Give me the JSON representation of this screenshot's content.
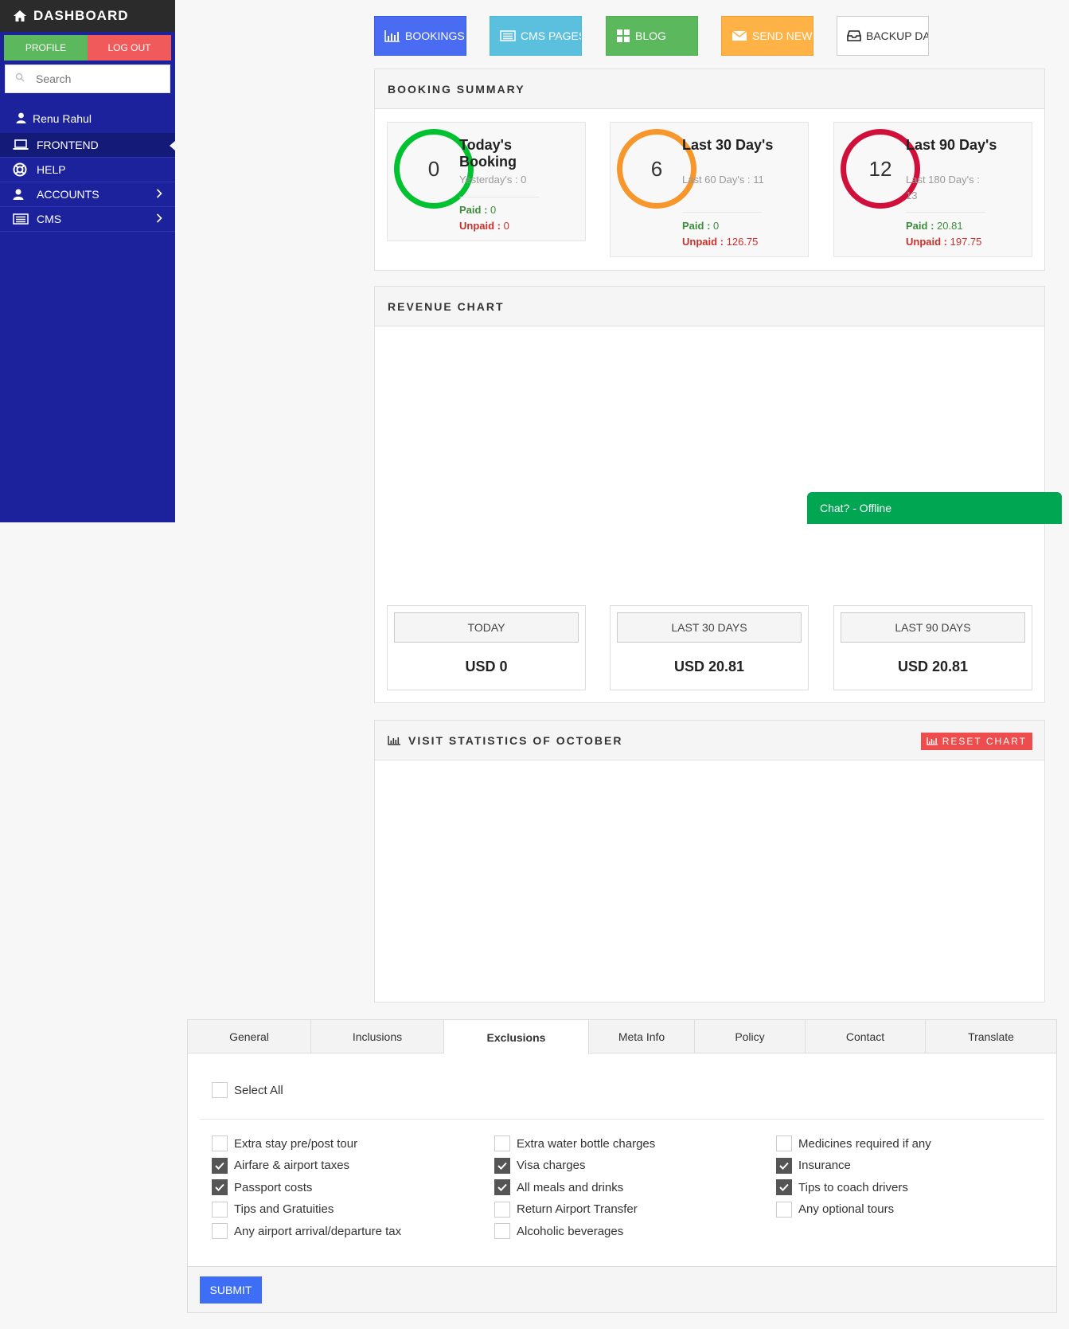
{
  "sidebar": {
    "title": "DASHBOARD",
    "profile_label": "PROFILE",
    "logout_label": "LOG OUT",
    "search_placeholder": "Search",
    "user_name": "Renu Rahul",
    "menu": [
      {
        "label": "FRONTEND",
        "icon": "laptop-icon",
        "active": true
      },
      {
        "label": "HELP",
        "icon": "lifebuoy-icon"
      },
      {
        "label": "ACCOUNTS",
        "icon": "user-icon",
        "has_children": true
      },
      {
        "label": "CMS",
        "icon": "list-icon",
        "has_children": true
      }
    ]
  },
  "top_buttons": [
    {
      "label": "BOOKINGS",
      "icon": "bar-chart-icon",
      "color": "#4a6cf3"
    },
    {
      "label": "CMS PAGES",
      "icon": "list-icon",
      "color": "#5bc0de"
    },
    {
      "label": "BLOG",
      "icon": "grid-icon",
      "color": "#5cb85c"
    },
    {
      "label": "SEND NEWSLETTER",
      "icon": "envelope-icon",
      "color": "#f0ad4e"
    },
    {
      "label": "BACKUP DATABSE",
      "icon": "inbox-icon",
      "color": "#ffffff"
    }
  ],
  "booking_summary": {
    "title": "BOOKING SUMMARY",
    "cards": [
      {
        "count": "0",
        "title": "Today's Booking",
        "sub": "Yesterday's : 0",
        "paid_label": "Paid :",
        "paid": "0",
        "unpaid_label": "Unpaid :",
        "unpaid": "0",
        "color": "#00c130"
      },
      {
        "count": "6",
        "title": "Last 30 Day's",
        "sub": "Last 60 Day's : 11",
        "paid_label": "Paid :",
        "paid": "0",
        "unpaid_label": "Unpaid :",
        "unpaid": "126.75",
        "color": "#f7962b"
      },
      {
        "count": "12",
        "title": "Last 90 Day's",
        "sub": "Last 180 Day's : 13",
        "paid_label": "Paid :",
        "paid": "20.81",
        "unpaid_label": "Unpaid :",
        "unpaid": "197.75",
        "color": "#d0103a"
      }
    ]
  },
  "revenue_chart": {
    "title": "REVENUE CHART",
    "cards": [
      {
        "label": "TODAY",
        "value": "USD 0"
      },
      {
        "label": "LAST 30 DAYS",
        "value": "USD 20.81"
      },
      {
        "label": "LAST 90 DAYS",
        "value": "USD 20.81"
      }
    ]
  },
  "chat": {
    "label": "Chat? - Offline"
  },
  "visit_stats": {
    "title": "VISIT STATISTICS OF OCTOBER",
    "reset_label": "RESET CHART"
  },
  "form": {
    "tabs": [
      "General",
      "Inclusions",
      "Exclusions",
      "Meta Info",
      "Policy",
      "Contact",
      "Translate"
    ],
    "active_tab": "Exclusions",
    "select_all": "Select All",
    "columns": [
      [
        {
          "label": "Extra stay pre/post tour",
          "checked": false
        },
        {
          "label": "Airfare & airport taxes",
          "checked": true
        },
        {
          "label": "Passport costs",
          "checked": true
        },
        {
          "label": "Tips and Gratuities",
          "checked": false
        },
        {
          "label": "Any airport arrival/departure tax",
          "checked": false
        }
      ],
      [
        {
          "label": "Extra water bottle charges",
          "checked": false
        },
        {
          "label": "Visa charges",
          "checked": true
        },
        {
          "label": "All meals and drinks",
          "checked": true
        },
        {
          "label": "Return Airport Transfer",
          "checked": false
        },
        {
          "label": "Alcoholic beverages",
          "checked": false
        }
      ],
      [
        {
          "label": "Medicines required if any",
          "checked": false
        },
        {
          "label": "Insurance",
          "checked": true
        },
        {
          "label": "Tips to coach drivers",
          "checked": true
        },
        {
          "label": "Any optional tours",
          "checked": false
        }
      ]
    ],
    "submit_label": "SUBMIT"
  }
}
